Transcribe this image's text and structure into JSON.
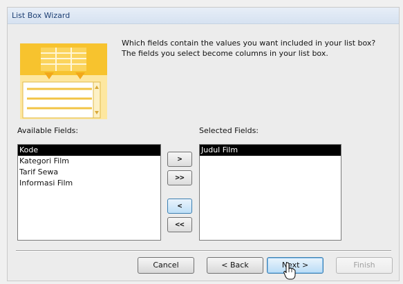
{
  "window": {
    "title": "List Box Wizard"
  },
  "instructions": {
    "line1": "Which fields contain the values you want included in your list box?",
    "line2": "The fields you select become columns in your list box."
  },
  "available": {
    "label": "Available Fields:",
    "items": [
      "Kode",
      "Kategori Film",
      "Tarif Sewa",
      "Informasi Film"
    ],
    "selected_index": 0
  },
  "selected": {
    "label": "Selected Fields:",
    "items": [
      "Judul Film"
    ],
    "selected_index": 0
  },
  "move_buttons": {
    "add_one": ">",
    "add_all": ">>",
    "remove_one": "<",
    "remove_all": "<<"
  },
  "footer": {
    "cancel": "Cancel",
    "back": "< Back",
    "next": "Next >",
    "finish": "Finish"
  },
  "colors": {
    "illustration_yellow": "#f7c32e",
    "illustration_light": "#fde7a0",
    "selection": "#000000"
  },
  "icons": {
    "illustration": "list-box-illustration-icon",
    "cursor": "mouse-pointer-icon"
  }
}
